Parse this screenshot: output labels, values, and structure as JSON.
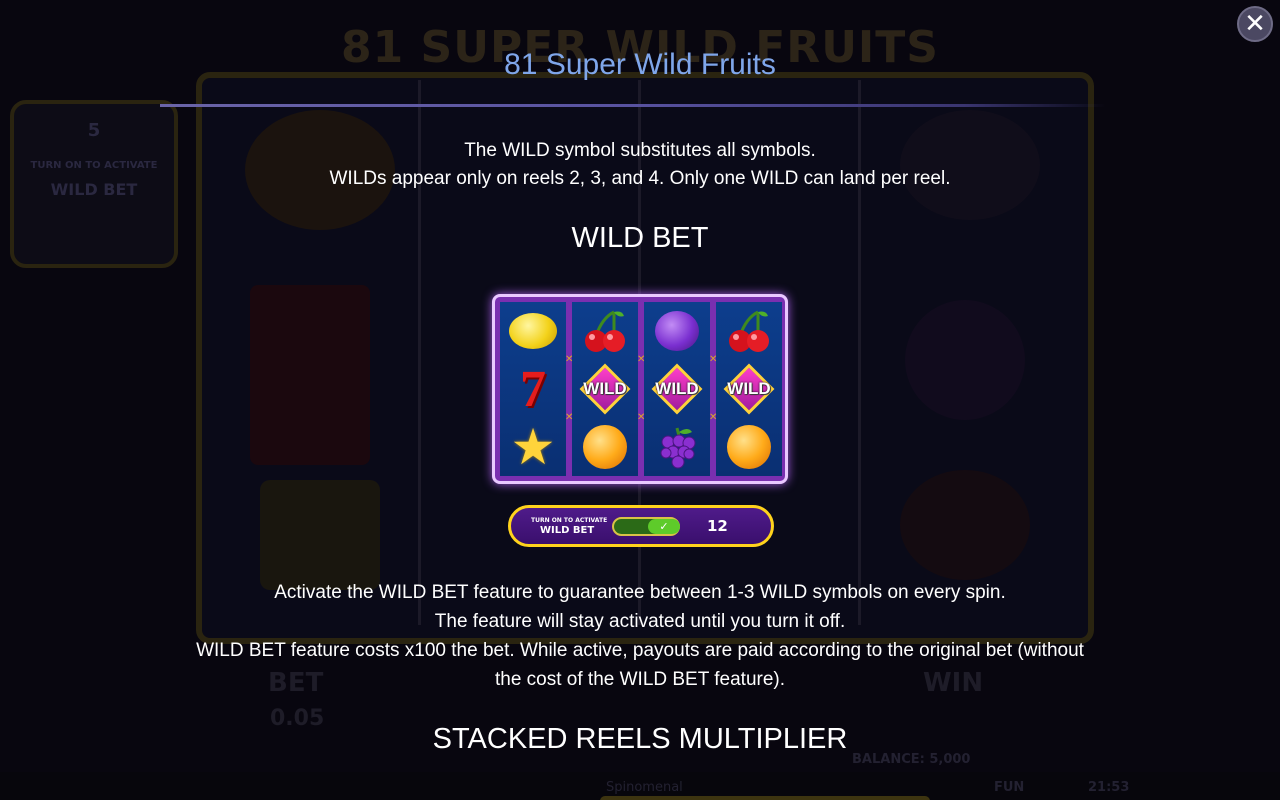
{
  "background": {
    "game_title": "81 SUPER WILD FRUITS",
    "side_panel": {
      "value": "5",
      "line1": "TURN ON TO ACTIVATE",
      "line2": "WILD BET"
    },
    "bet_label": "BET",
    "bet_value": "0.05",
    "win_label": "WIN",
    "balance": "BALANCE: 5,000",
    "provider": "Spinomenal",
    "mode": "FUN",
    "clock": "21:53"
  },
  "overlay": {
    "title": "81 Super Wild Fruits",
    "close_icon": "close-icon",
    "intro_line1": "The WILD symbol substitutes all symbols.",
    "intro_line2": "WILDs appear only on reels 2, 3, and 4. Only one WILD can land per reel.",
    "section1_heading": "WILD BET",
    "reels_preview": {
      "columns": [
        [
          "lemon",
          "seven",
          "star"
        ],
        [
          "cherries",
          "wild",
          "orange"
        ],
        [
          "plum",
          "wild",
          "grapes"
        ],
        [
          "cherries",
          "wild",
          "orange"
        ]
      ],
      "wild_text": "WILD"
    },
    "toggle": {
      "line1": "TURN ON TO ACTIVATE",
      "line2": "WILD BET",
      "value": "12",
      "state": "on"
    },
    "body_line1": "Activate the WILD BET feature to guarantee between 1-3 WILD symbols on every spin.",
    "body_line2": "The feature will stay activated until you turn it off.",
    "body_line3": "WILD BET feature costs x100 the bet. While active, payouts are paid according to the original bet (without",
    "body_line4": "the cost of the WILD BET feature).",
    "section2_heading": "STACKED REELS MULTIPLIER"
  },
  "colors": {
    "title": "#7fa6ea",
    "accent_gold": "#ffd31c",
    "frame_purple": "#7a2fb0"
  }
}
